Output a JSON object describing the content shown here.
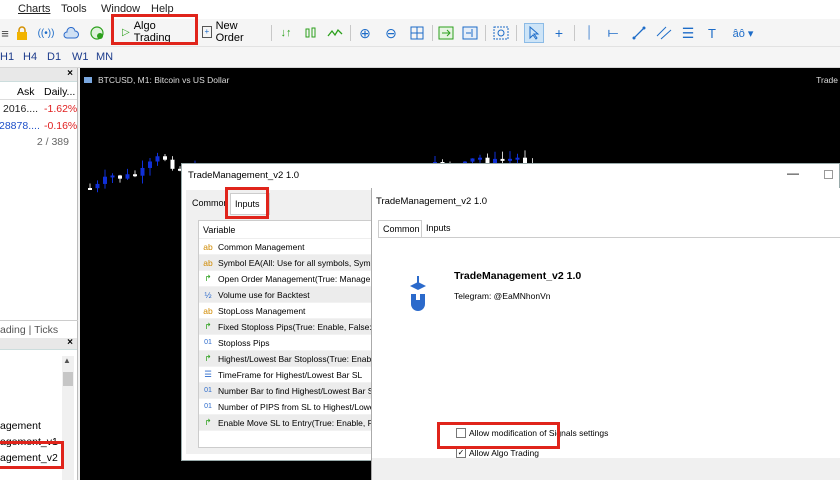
{
  "menu": {
    "items": [
      "Charts",
      "Tools",
      "Window",
      "Help"
    ]
  },
  "toolbar": {
    "algo_trading_label": "Algo Trading",
    "new_order_label": "New Order"
  },
  "timeframes": [
    "H1",
    "H4",
    "D1",
    "W1",
    "MN"
  ],
  "market_watch": {
    "columns": {
      "ask": "Ask",
      "daily": "Daily..."
    },
    "rows": [
      {
        "ask": "2016....",
        "daily": "-1.62%"
      },
      {
        "ask": "28878....",
        "daily": "-0.16%"
      }
    ],
    "count": "2 / 389",
    "tabs_label": "ading | Ticks"
  },
  "navigator": {
    "items": [
      "agement",
      "agement_v1",
      "agement_v2"
    ]
  },
  "chart": {
    "title": "BTCUSD, M1: Bitcoin vs US Dollar",
    "right_label": "Trade"
  },
  "dialog1": {
    "title": "TradeManagement_v2 1.0",
    "tabs": {
      "common": "Common",
      "inputs": "Inputs"
    },
    "variable_header": "Variable",
    "variables": [
      {
        "icon": "ab",
        "label": "Common Management"
      },
      {
        "icon": "ab",
        "label": "Symbol EA(All: Use for all symbols,  Symbol"
      },
      {
        "icon": "↱",
        "label": "Open Order Management(True: Manage C"
      },
      {
        "icon": "½",
        "label": "Volume use for Backtest"
      },
      {
        "icon": "ab",
        "label": "StopLoss Management"
      },
      {
        "icon": "↱",
        "label": "Fixed Stoploss Pips(True: Enable, False: D"
      },
      {
        "icon": "01",
        "label": "Stoploss Pips"
      },
      {
        "icon": "↱",
        "label": "Highest/Lowest Bar Stoploss(True: Enable"
      },
      {
        "icon": "☰",
        "label": "TimeFrame for Highest/Lowest Bar SL"
      },
      {
        "icon": "01",
        "label": "Number Bar to find Highest/Lowest Bar St"
      },
      {
        "icon": "01",
        "label": "Number of PIPS from SL to Highest/Lowes"
      },
      {
        "icon": "↱",
        "label": "Enable Move SL to Entry(True: Enable, Fal"
      }
    ]
  },
  "dialog2": {
    "title": "TradeManagement_v2 1.0",
    "tabs": {
      "common": "Common",
      "inputs": "Inputs"
    },
    "ea_name": "TradeManagement_v2 1.0",
    "telegram": "Telegram: @EaMNhonVn",
    "allow_signals_label": "Allow modification of Signals settings",
    "allow_algo_label": "Allow Algo Trading",
    "allow_signals_checked": false,
    "allow_algo_checked": true
  },
  "colors": {
    "highlight": "#e0241b",
    "candle_up": "#1030d8",
    "candle_down": "#ffffff",
    "negative": "#e02020"
  }
}
